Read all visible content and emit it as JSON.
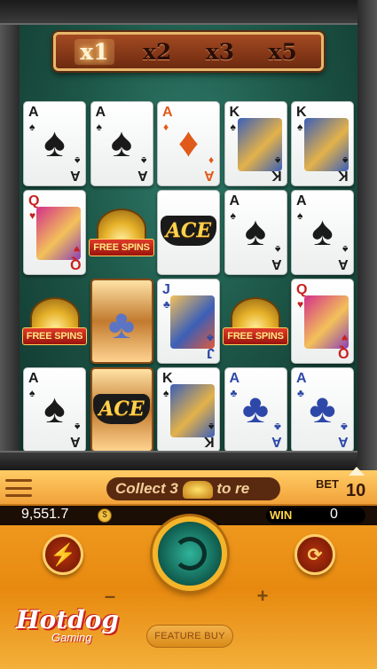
{
  "multipliers": [
    "x1",
    "x2",
    "x3",
    "x5"
  ],
  "active_multiplier_index": 0,
  "reels": [
    [
      {
        "type": "card",
        "rank": "A",
        "suit": "♠",
        "color": "black"
      },
      {
        "type": "card",
        "rank": "A",
        "suit": "♠",
        "color": "black"
      },
      {
        "type": "card",
        "rank": "A",
        "suit": "♦",
        "color": "orange"
      },
      {
        "type": "face",
        "rank": "K",
        "suit": "♠",
        "color": "black",
        "face": "king"
      },
      {
        "type": "face",
        "rank": "K",
        "suit": "♠",
        "color": "black",
        "face": "king"
      }
    ],
    [
      {
        "type": "face",
        "rank": "Q",
        "suit": "♥",
        "color": "red",
        "face": "queen"
      },
      {
        "type": "scatter",
        "label": "FREE SPINS"
      },
      {
        "type": "ace_wild",
        "label": "ACE"
      },
      {
        "type": "card",
        "rank": "A",
        "suit": "♠",
        "color": "black"
      },
      {
        "type": "card",
        "rank": "A",
        "suit": "♠",
        "color": "black"
      }
    ],
    [
      {
        "type": "scatter",
        "label": "FREE SPINS"
      },
      {
        "type": "gold",
        "suit": "♣"
      },
      {
        "type": "face",
        "rank": "J",
        "suit": "♣",
        "color": "blue",
        "face": "jack"
      },
      {
        "type": "scatter",
        "label": "FREE SPINS"
      },
      {
        "type": "face",
        "rank": "Q",
        "suit": "♥",
        "color": "red",
        "face": "queen"
      }
    ],
    [
      {
        "type": "card",
        "rank": "A",
        "suit": "♠",
        "color": "black"
      },
      {
        "type": "gold_ace",
        "label": "ACE"
      },
      {
        "type": "face",
        "rank": "K",
        "suit": "♠",
        "color": "black",
        "face": "king"
      },
      {
        "type": "card",
        "rank": "A",
        "suit": "♣",
        "color": "blue"
      },
      {
        "type": "card",
        "rank": "A",
        "suit": "♣",
        "color": "blue"
      }
    ]
  ],
  "info": {
    "marquee": "Collect 3",
    "marquee_tail": "to re",
    "bet_label": "BET",
    "bet_value": "10"
  },
  "balance": {
    "value": "9,551.7",
    "coin_symbol": "$",
    "win_label": "WIN",
    "win_value": "0"
  },
  "controls": {
    "minus": "–",
    "plus": "+",
    "feature_buy": "FEATURE BUY"
  },
  "logo": {
    "main": "Hotdog",
    "sub": "Gaming"
  },
  "colors": {
    "panel": "#f5a52a",
    "table": "#1c5546",
    "multiplier_bar": "#a34a22",
    "spin_button": "#2fb39a"
  }
}
